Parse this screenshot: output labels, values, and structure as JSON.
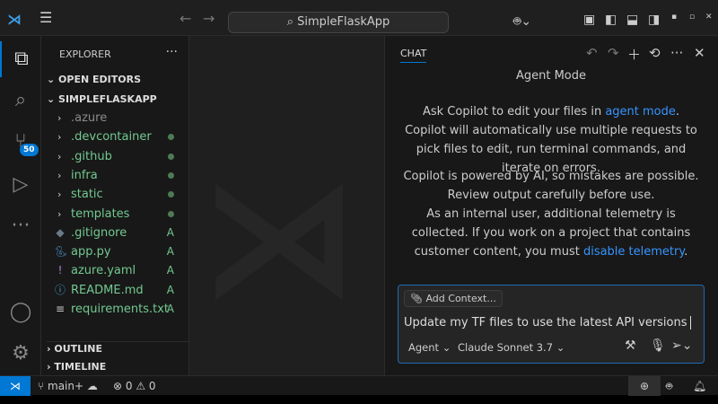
{
  "titlebar": {
    "search": "SimpleFlaskApp"
  },
  "activity": {
    "scm_badge": "50"
  },
  "explorer": {
    "title": "EXPLORER",
    "open_editors": "OPEN EDITORS",
    "project": "SIMPLEFLASKAPP",
    "items": [
      {
        "name": ".azure",
        "type": "folder",
        "status": ""
      },
      {
        "name": ".devcontainer",
        "type": "folder",
        "status": "dot"
      },
      {
        "name": ".github",
        "type": "folder",
        "status": "dot"
      },
      {
        "name": "infra",
        "type": "folder",
        "status": "dot"
      },
      {
        "name": "static",
        "type": "folder",
        "status": "dot"
      },
      {
        "name": "templates",
        "type": "folder",
        "status": "dot"
      },
      {
        "name": ".gitignore",
        "type": "file",
        "status": "A"
      },
      {
        "name": "app.py",
        "type": "file",
        "status": "A"
      },
      {
        "name": "azure.yaml",
        "type": "file",
        "status": "A"
      },
      {
        "name": "README.md",
        "type": "file",
        "status": "A"
      },
      {
        "name": "requirements.txt",
        "type": "file",
        "status": "A"
      }
    ],
    "outline": "OUTLINE",
    "timeline": "TIMELINE"
  },
  "chat": {
    "tab": "CHAT",
    "heading": "Agent Mode",
    "p1_a": "Ask Copilot to edit your files in ",
    "p1_link": "agent mode",
    "p1_b": ". Copilot will automatically use multiple requests to pick files to edit, run terminal commands, and iterate on errors.",
    "p2": "Copilot is powered by AI, so mistakes are possible. Review output carefully before use.",
    "p3_a": "As an internal user, additional telemetry is collected. If you work on a project that contains customer content, you must ",
    "p3_link": "disable telemetry",
    "p3_b": ".",
    "add_context": "Add Context...",
    "prompt": "Update my TF files to use the latest API versions",
    "mode": "Agent",
    "model": "Claude Sonnet 3.7"
  },
  "status": {
    "branch": "main+",
    "errors": "0",
    "warnings": "0"
  }
}
